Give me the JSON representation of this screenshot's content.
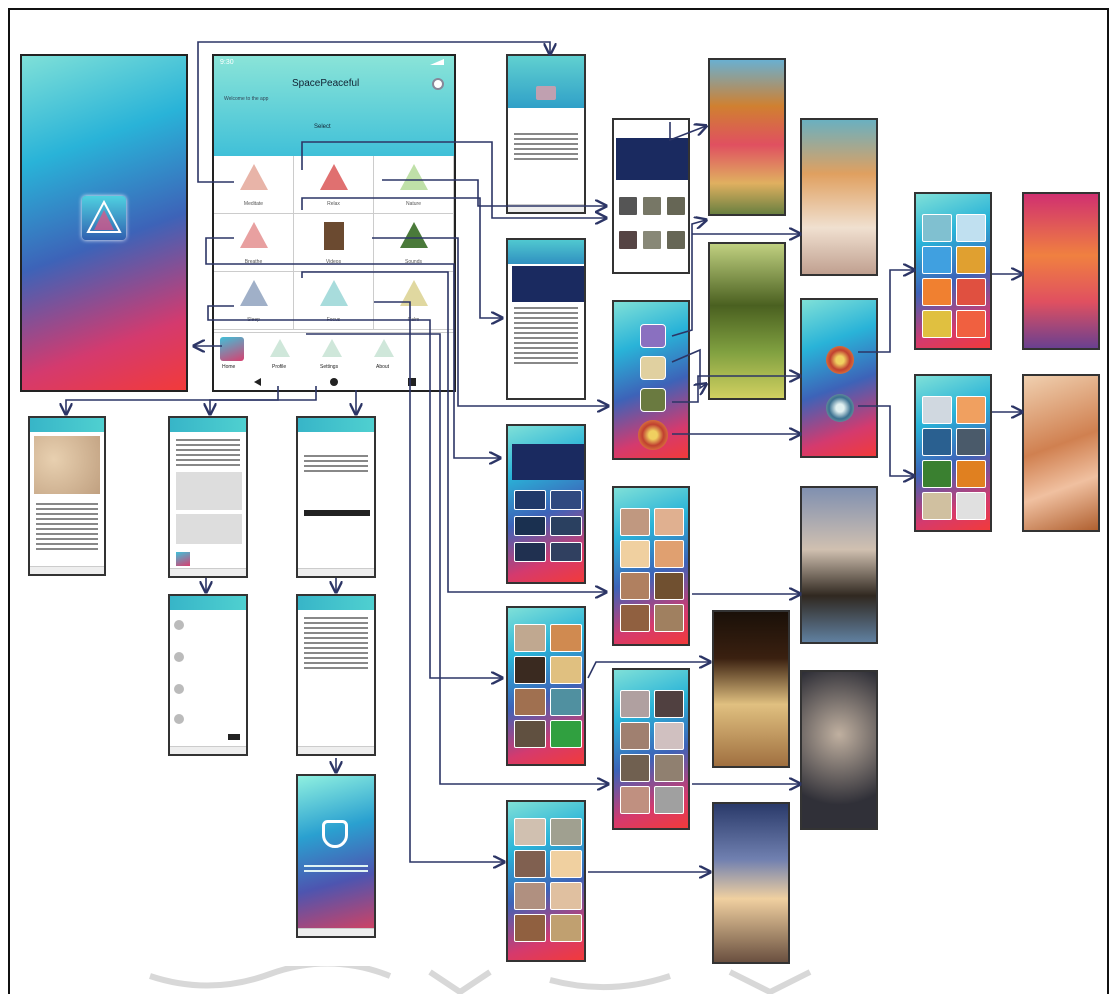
{
  "main_screen": {
    "status_time": "9:30",
    "app_title": "SpacePeaceful",
    "subtitle": "Welcome to the app",
    "section_label": "Select",
    "grid_items": [
      {
        "label": "Meditate",
        "color": "#c98b8b"
      },
      {
        "label": "Relax",
        "color": "#d04040"
      },
      {
        "label": "Nature",
        "color": "#9bc488"
      },
      {
        "label": "Breathe",
        "color": "#c46060"
      },
      {
        "label": "Videos",
        "color": "#6b4a30"
      },
      {
        "label": "Sounds",
        "color": "#4a7a3a"
      },
      {
        "label": "Sleep",
        "color": "#506a8a"
      },
      {
        "label": "Focus",
        "color": "#5ab0b0"
      },
      {
        "label": "Calm",
        "color": "#b0a060"
      }
    ],
    "bottom_items": [
      {
        "label": "Home"
      },
      {
        "label": "Profile"
      },
      {
        "label": "Settings"
      },
      {
        "label": "About"
      }
    ]
  },
  "colors": {
    "arrow": "#2c3566",
    "frame": "#111111",
    "header_teal": "#37b5c8"
  }
}
